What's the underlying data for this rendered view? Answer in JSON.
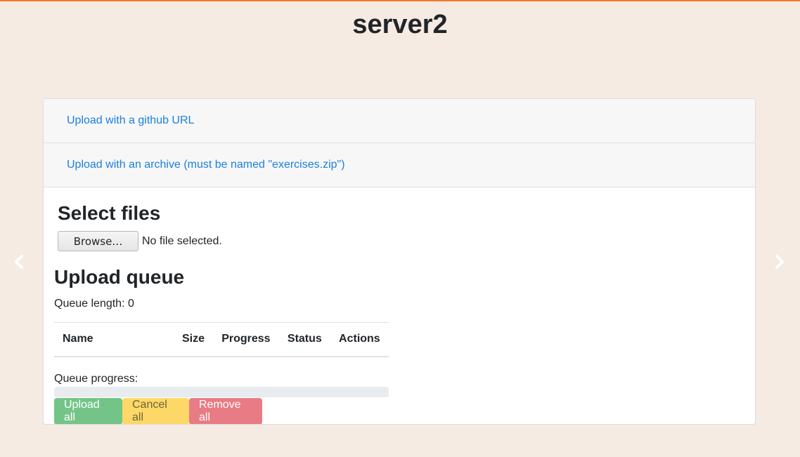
{
  "page": {
    "title": "server2"
  },
  "nav": {
    "prev_icon": "chevron-left-icon",
    "next_icon": "chevron-right-icon"
  },
  "upload_options": {
    "github_label": "Upload with a github URL",
    "archive_label": "Upload with an archive (must be named \"exercises.zip\")"
  },
  "select_files": {
    "heading": "Select files",
    "browse_label": "Browse…",
    "file_status": "No file selected."
  },
  "queue": {
    "heading": "Upload queue",
    "length_text": "Queue length: 0",
    "columns": [
      "Name",
      "Size",
      "Progress",
      "Status",
      "Actions"
    ],
    "progress_label": "Queue progress:",
    "progress_value": 0
  },
  "actions": {
    "upload_all": "Upload all",
    "cancel_all": "Cancel all",
    "remove_all": "Remove all"
  },
  "colors": {
    "accent_top": "#f07a2c",
    "link": "#1a7fe0",
    "success": "#74c487",
    "warning": "#fed866",
    "danger": "#e97b84"
  }
}
